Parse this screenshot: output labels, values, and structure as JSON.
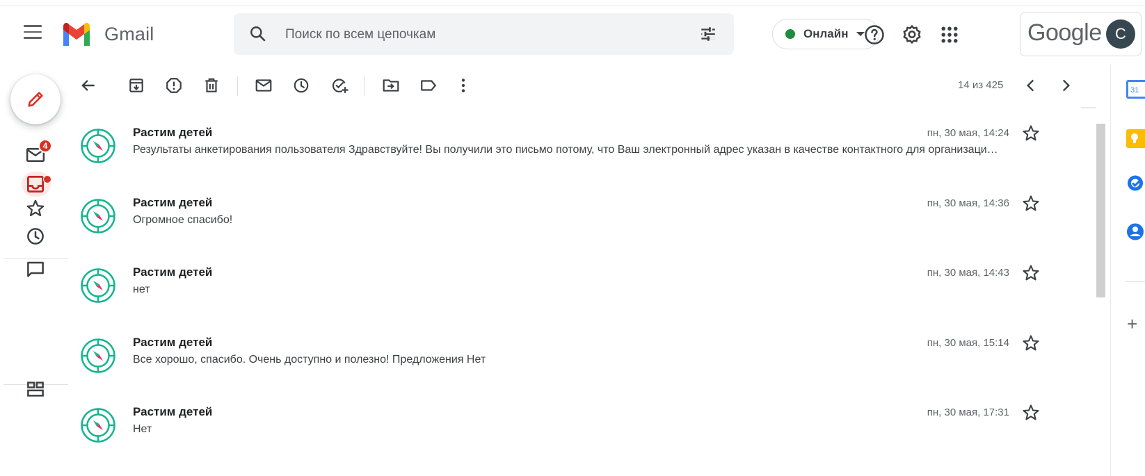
{
  "app": {
    "name": "Gmail"
  },
  "search": {
    "placeholder": "Поиск по всем цепочкам"
  },
  "status": {
    "label": "Онлайн",
    "color": "#1e8e3e"
  },
  "account": {
    "brand": "Google",
    "avatar_letter": "С"
  },
  "nav": {
    "mail_badge": "4"
  },
  "pager": {
    "text": "14 из 425"
  },
  "side_apps": {
    "calendar_day": "31"
  },
  "messages": [
    {
      "sender": "Растим детей",
      "snippet": "Результаты анкетирования пользователя Здравствуйте! Вы получили это письмо потому, что Ваш электронный адрес указан в качестве контактного для организаци…",
      "date": "пн, 30 мая, 14:24"
    },
    {
      "sender": "Растим детей",
      "snippet": "Огромное спасибо!",
      "date": "пн, 30 мая, 14:36"
    },
    {
      "sender": "Растим детей",
      "snippet": "нет",
      "date": "пн, 30 мая, 14:43"
    },
    {
      "sender": "Растим детей",
      "snippet": "Все хорошо, спасибо. Очень доступно и полезно! Предложения Нет",
      "date": "пн, 30 мая, 15:14"
    },
    {
      "sender": "Растим детей",
      "snippet": "Нет",
      "date": "пн, 30 мая, 17:31"
    }
  ],
  "colors": {
    "accent_red": "#d93025",
    "avatar_teal": "#12b58f",
    "avatar_pink": "#e8336d"
  }
}
